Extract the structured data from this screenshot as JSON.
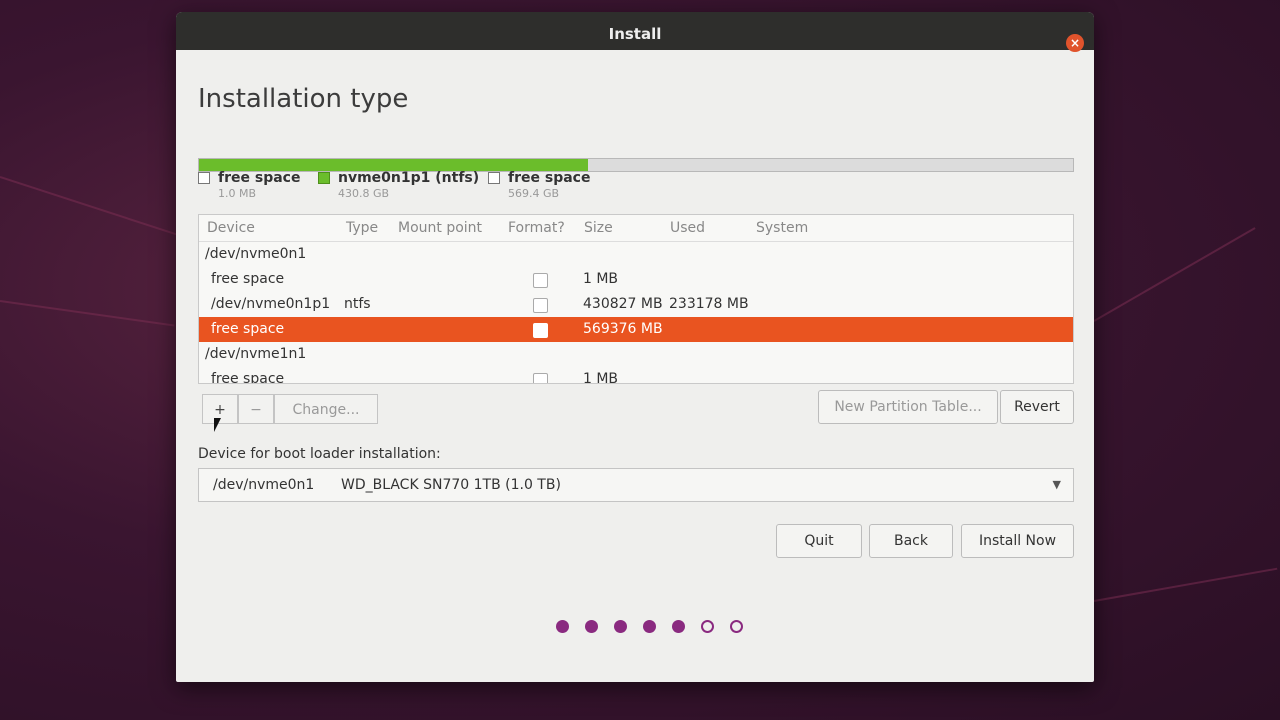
{
  "window": {
    "title": "Install",
    "close_label": "×"
  },
  "page": {
    "heading": "Installation type"
  },
  "disk_bar": {
    "used_fraction": 0.445,
    "fill_color": "#6bbd2b"
  },
  "legend": [
    {
      "name": "free space",
      "size": "1.0 MB",
      "swatch": "white"
    },
    {
      "name": "nvme0n1p1 (ntfs)",
      "size": "430.8 GB",
      "swatch": "green"
    },
    {
      "name": "free space",
      "size": "569.4 GB",
      "swatch": "white"
    }
  ],
  "table": {
    "headers": [
      "Device",
      "Type",
      "Mount point",
      "Format?",
      "Size",
      "Used",
      "System"
    ],
    "rows": [
      {
        "device": "/dev/nvme0n1",
        "type": "",
        "mount": "",
        "size": "",
        "used": "",
        "checkbox": false,
        "indent": false,
        "selected": false
      },
      {
        "device": "free space",
        "type": "",
        "mount": "",
        "size": "1 MB",
        "used": "",
        "checkbox": true,
        "indent": true,
        "selected": false
      },
      {
        "device": "/dev/nvme0n1p1",
        "type": "ntfs",
        "mount": "",
        "size": "430827 MB",
        "used": "233178 MB",
        "checkbox": true,
        "indent": true,
        "selected": false
      },
      {
        "device": "free space",
        "type": "",
        "mount": "",
        "size": "569376 MB",
        "used": "",
        "checkbox": true,
        "indent": true,
        "selected": true
      },
      {
        "device": "/dev/nvme1n1",
        "type": "",
        "mount": "",
        "size": "",
        "used": "",
        "checkbox": false,
        "indent": false,
        "selected": false
      },
      {
        "device": "free space",
        "type": "",
        "mount": "",
        "size": "1 MB",
        "used": "",
        "checkbox": true,
        "indent": true,
        "selected": false
      }
    ]
  },
  "partition_buttons": {
    "add": "+",
    "remove": "−",
    "change": "Change..."
  },
  "table_actions": {
    "new_partition_table": "New Partition Table...",
    "revert": "Revert"
  },
  "bootloader": {
    "label": "Device for boot loader installation:",
    "device": "/dev/nvme0n1",
    "description": "WD_BLACK SN770 1TB (1.0 TB)"
  },
  "nav": {
    "quit": "Quit",
    "back": "Back",
    "install_now": "Install Now"
  },
  "progress": {
    "total_steps": 7,
    "completed_steps": 5,
    "accent": "#8a2a80"
  },
  "colors": {
    "selection": "#e95420",
    "close": "#e0532c"
  }
}
